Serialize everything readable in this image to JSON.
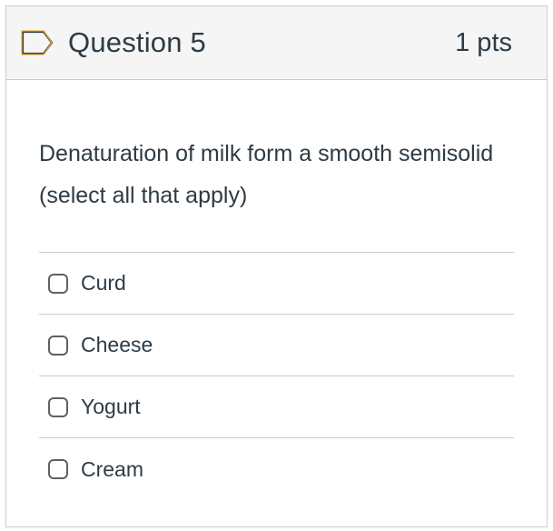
{
  "question": {
    "title": "Question 5",
    "points": "1 pts",
    "flag_icon": "flag-outline-icon",
    "text": "Denaturation of milk form a smooth semisolid (select all that apply)"
  },
  "answers": [
    {
      "label": "Curd",
      "checked": false
    },
    {
      "label": "Cheese",
      "checked": false
    },
    {
      "label": "Yogurt",
      "checked": false
    },
    {
      "label": "Cream",
      "checked": false
    }
  ],
  "colors": {
    "text": "#2d3b45",
    "border": "#c7cdd1",
    "header_bg": "#f5f5f5",
    "flag_fill": "#f0b020",
    "checkbox_border": "#5a6266"
  }
}
